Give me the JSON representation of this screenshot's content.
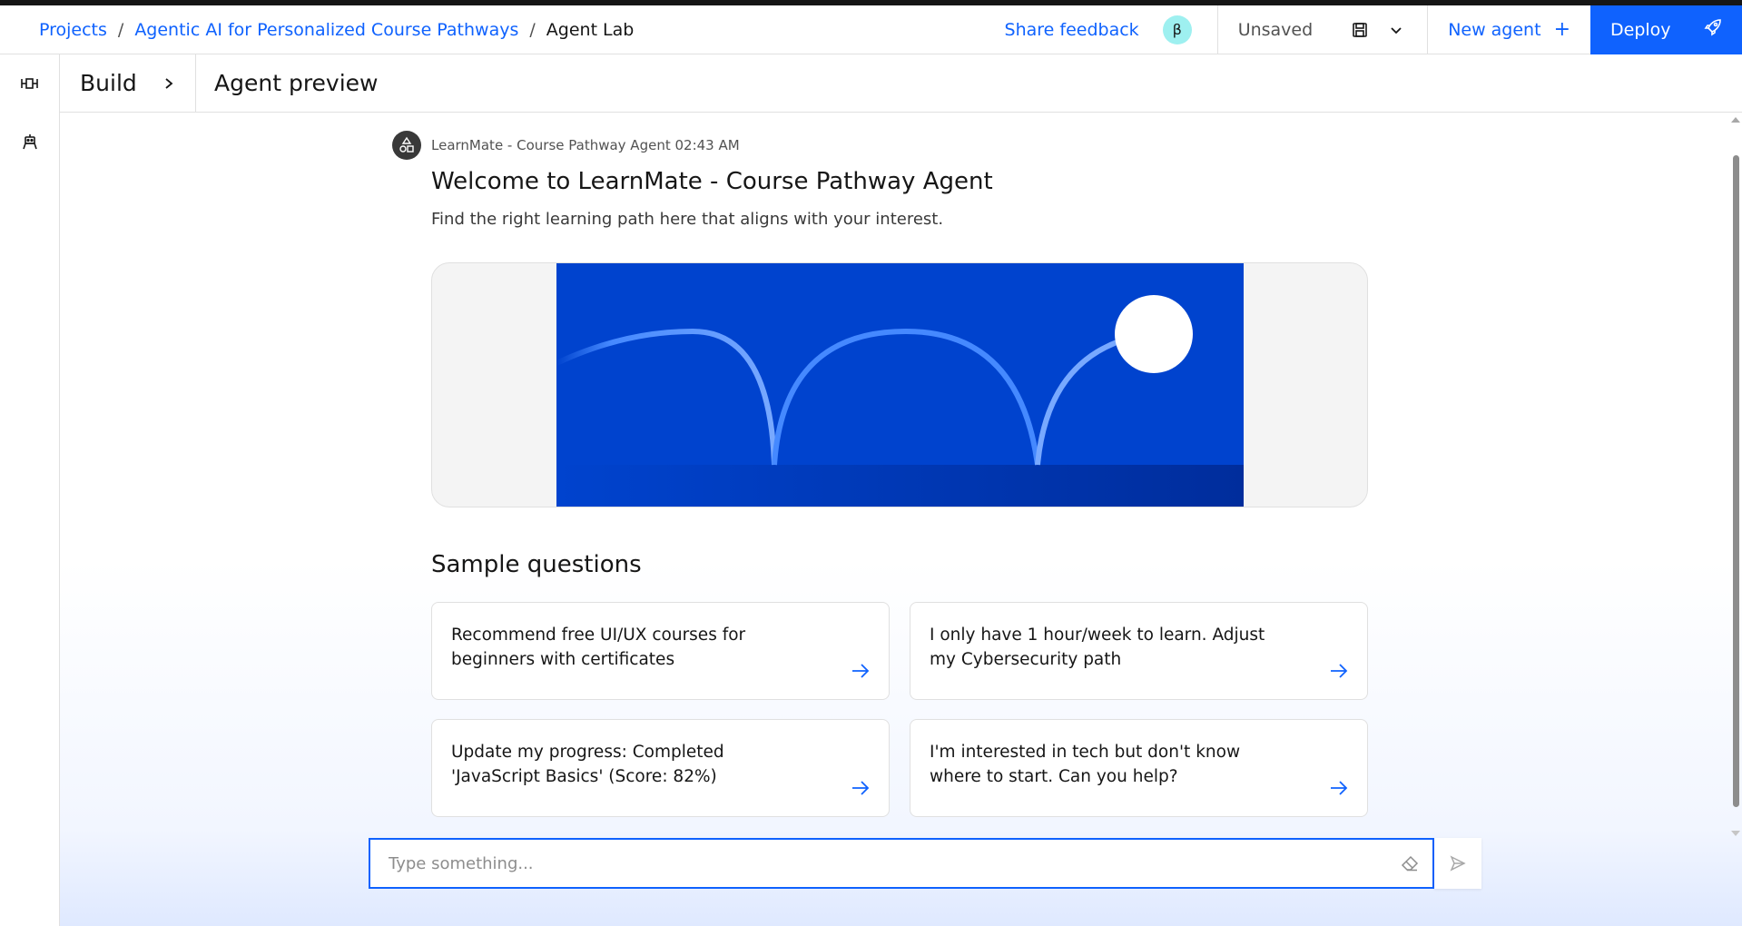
{
  "header": {
    "breadcrumb": [
      {
        "label": "Projects"
      },
      {
        "label": "Agentic AI for Personalized Course Pathways"
      }
    ],
    "breadcrumb_separator": "/",
    "current_page": "Agent Lab",
    "share_feedback": "Share feedback",
    "beta_badge": "β",
    "save_status": "Unsaved",
    "new_agent_label": "New agent",
    "new_agent_plus": "+",
    "deploy_label": "Deploy"
  },
  "subheader": {
    "build_label": "Build",
    "preview_title": "Agent preview"
  },
  "message": {
    "meta": "LearnMate - Course Pathway Agent 02:43 AM",
    "welcome": "Welcome to LearnMate - Course Pathway Agent",
    "subtext": "Find the right learning path here that aligns with your interest."
  },
  "sample": {
    "title": "Sample questions",
    "questions": [
      {
        "text": "Recommend free UI/UX courses for beginners with certificates"
      },
      {
        "text": "I only have 1 hour/week to learn. Adjust my Cybersecurity path"
      },
      {
        "text": "Update my progress: Completed 'JavaScript Basics' (Score: 82%)"
      },
      {
        "text": "I'm interested in tech but don't know where to start. Can you help?"
      }
    ]
  },
  "input": {
    "value": "",
    "placeholder": "Type something..."
  },
  "icons": {
    "rail_top": "flow-icon",
    "rail_bottom": "agent-icon",
    "save": "save-icon",
    "chevron": "chevron-down-icon",
    "deploy": "rocket-icon",
    "build_chevron": "chevron-right-icon",
    "avatar": "shapes-icon",
    "card_arrow": "arrow-right-icon",
    "eraser": "eraser-icon",
    "send": "send-icon"
  },
  "colors": {
    "accent": "#0f62fe",
    "banner_blue": "#0043ce",
    "beta_badge": "#9ef0f0"
  }
}
